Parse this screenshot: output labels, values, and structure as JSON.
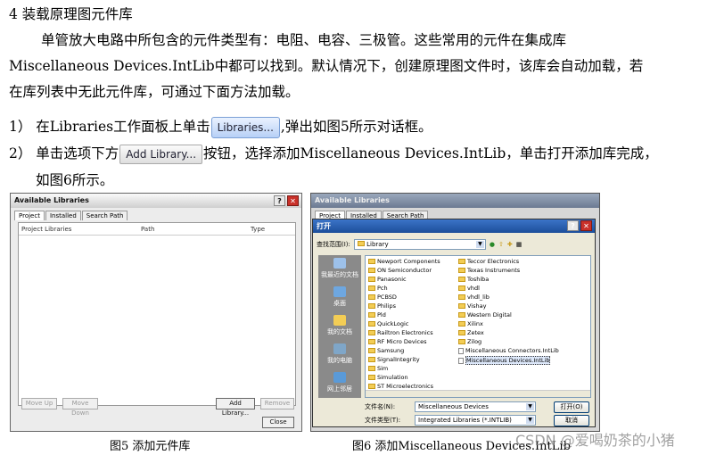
{
  "text": {
    "heading": "4 装载原理图元件库",
    "p1": "单管放大电路中所包含的元件类型有：电阻、电容、三极管。这些常用的元件在集成库",
    "p2": "Miscellaneous Devices.IntLib中都可以找到。默认情况下，创建原理图文件时，该库会自动加载，若",
    "p3": "在库列表中无此元件库，可通过下面方法加载。",
    "s1_before": "1） 在Libraries工作面板上单击",
    "s1_btn": "Libraries...",
    "s1_after": ",弹出如图5所示对话框。",
    "s2_before": "2） 单击选项下方",
    "s2_btn": "Add Library...",
    "s2_after": "按钮，选择添加Miscellaneous Devices.IntLib，单击打开添加库完成，",
    "s2b": "如图6所示。"
  },
  "fig5": {
    "title": "Available Libraries",
    "tabs": [
      "Project",
      "Installed",
      "Search Path"
    ],
    "columns": [
      "Project Libraries",
      "Path",
      "Type"
    ],
    "buttons": {
      "move_up": "Move Up",
      "move_down": "Move Down",
      "add_library": "Add Library...",
      "remove": "Remove",
      "close": "Close"
    },
    "caption": "图5 添加元件库"
  },
  "fig6": {
    "bg_title": "Available Libraries",
    "tabs": [
      "Project",
      "Installed",
      "Search Path"
    ],
    "dialog_title": "打开",
    "look_in_label": "查找范围(I):",
    "look_in_value": "Library",
    "places": [
      "我最近的文档",
      "桌面",
      "我的文档",
      "我的电脑",
      "网上邻居"
    ],
    "files_col1": [
      "Newport Components",
      "ON Semiconductor",
      "Panasonic",
      "Pch",
      "PCBSD",
      "Philips",
      "Pld",
      "QuickLogic",
      "Railtron Electronics",
      "RF Micro Devices",
      "Samsung",
      "SignalIntegrity",
      "Sim",
      "Simulation",
      "ST Microelectronics"
    ],
    "files_col2": [
      "Teccor Electronics",
      "Texas Instruments",
      "Toshiba",
      "vhdl",
      "vhdl_lib",
      "Vishay",
      "Western Digital",
      "Xilinx",
      "Zetex",
      "Zilog",
      "Miscellaneous Connectors.IntLib",
      "Miscellaneous Devices.IntLib"
    ],
    "filename_label": "文件名(N):",
    "filename_value": "Miscellaneous Devices",
    "filetype_label": "文件类型(T):",
    "filetype_value": "Integrated Libraries (*.INTLIB)",
    "open_btn": "打开(O)",
    "cancel_btn": "取消",
    "caption": "图6 添加Miscellaneous Devices.IntLib"
  },
  "watermark": "CSDN @爱喝奶茶的小猪"
}
